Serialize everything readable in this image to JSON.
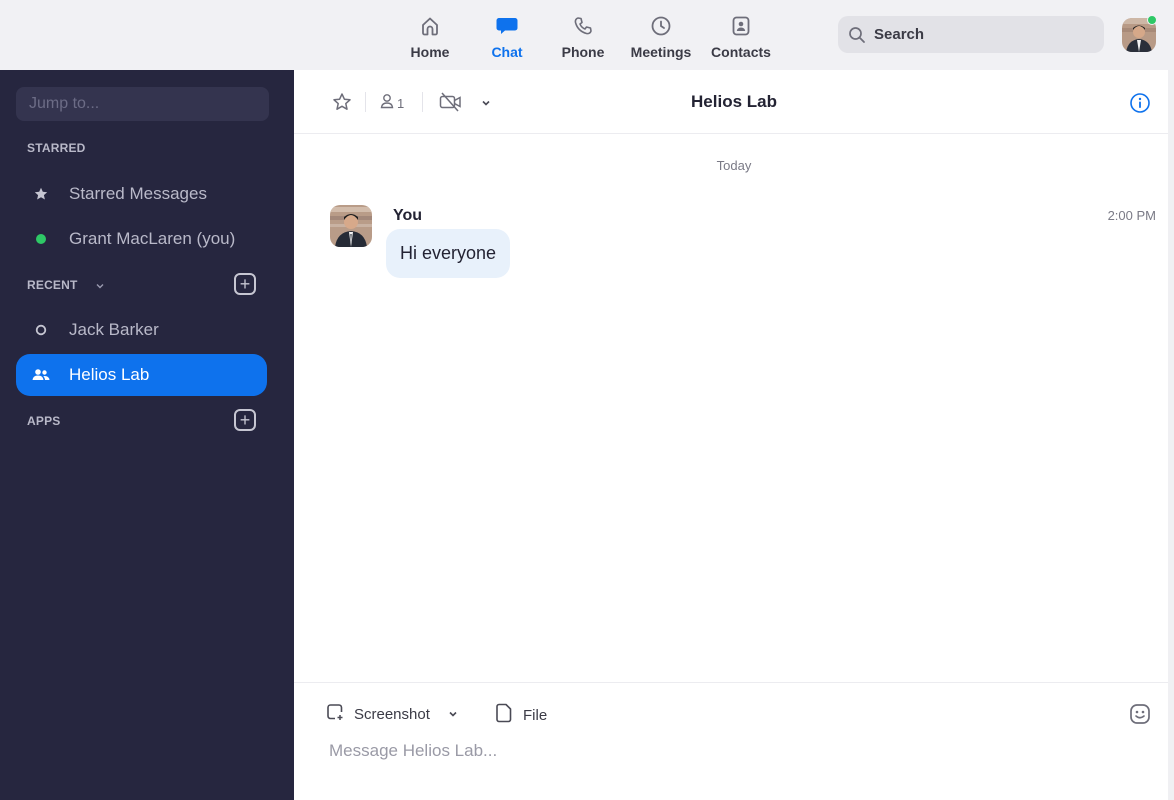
{
  "topnav": {
    "items": [
      {
        "label": "Home",
        "icon": "home-icon",
        "active": false
      },
      {
        "label": "Chat",
        "icon": "chat-icon",
        "active": true
      },
      {
        "label": "Phone",
        "icon": "phone-icon",
        "active": false
      },
      {
        "label": "Meetings",
        "icon": "clock-icon",
        "active": false
      },
      {
        "label": "Contacts",
        "icon": "contacts-icon",
        "active": false
      }
    ],
    "search_placeholder": "Search",
    "presence_status": "online"
  },
  "sidebar": {
    "jump_placeholder": "Jump to...",
    "starred_header": "STARRED",
    "starred_items": [
      {
        "label": "Starred Messages",
        "icon": "star-icon"
      },
      {
        "label": "Grant MacLaren (you)",
        "icon": "online-dot-icon"
      }
    ],
    "recent_header": "RECENT",
    "recent_items": [
      {
        "label": "Jack Barker",
        "icon": "offline-circle-icon",
        "active": false
      },
      {
        "label": "Helios Lab",
        "icon": "group-icon",
        "active": true
      }
    ],
    "apps_header": "APPS",
    "add_symbol": "+"
  },
  "chat": {
    "title": "Helios Lab",
    "member_count": "1",
    "day_divider": "Today",
    "messages": [
      {
        "sender": "You",
        "time": "2:00 PM",
        "text": "Hi everyone"
      }
    ]
  },
  "composer": {
    "screenshot_label": "Screenshot",
    "file_label": "File",
    "placeholder": "Message Helios Lab..."
  },
  "colors": {
    "accent": "#0e72ed",
    "sidebar_bg": "#26263f",
    "bubble_bg": "#e8f1fb",
    "online": "#2ec866"
  }
}
